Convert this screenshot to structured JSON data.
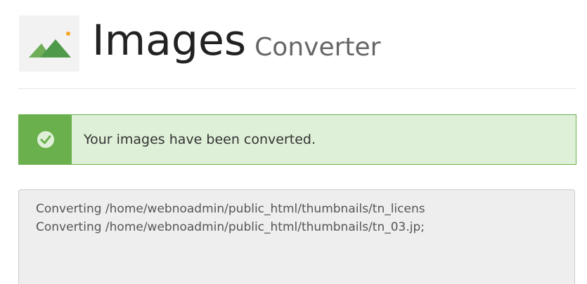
{
  "header": {
    "title": "Images",
    "subtitle": "Converter",
    "icon": "images-icon"
  },
  "alert": {
    "type": "success",
    "icon": "check-circle-icon",
    "message": "Your images have been converted."
  },
  "output": {
    "lines": [
      "Converting /home/webnoadmin/public_html/thumbnails/tn_licens",
      "Converting /home/webnoadmin/public_html/thumbnails/tn_03.jp;"
    ]
  },
  "colors": {
    "success_border": "#6ab04c",
    "success_bg": "#dff0d8",
    "output_bg": "#eeeeee",
    "icon_green": "#5aa557",
    "icon_orange": "#f5a623"
  }
}
